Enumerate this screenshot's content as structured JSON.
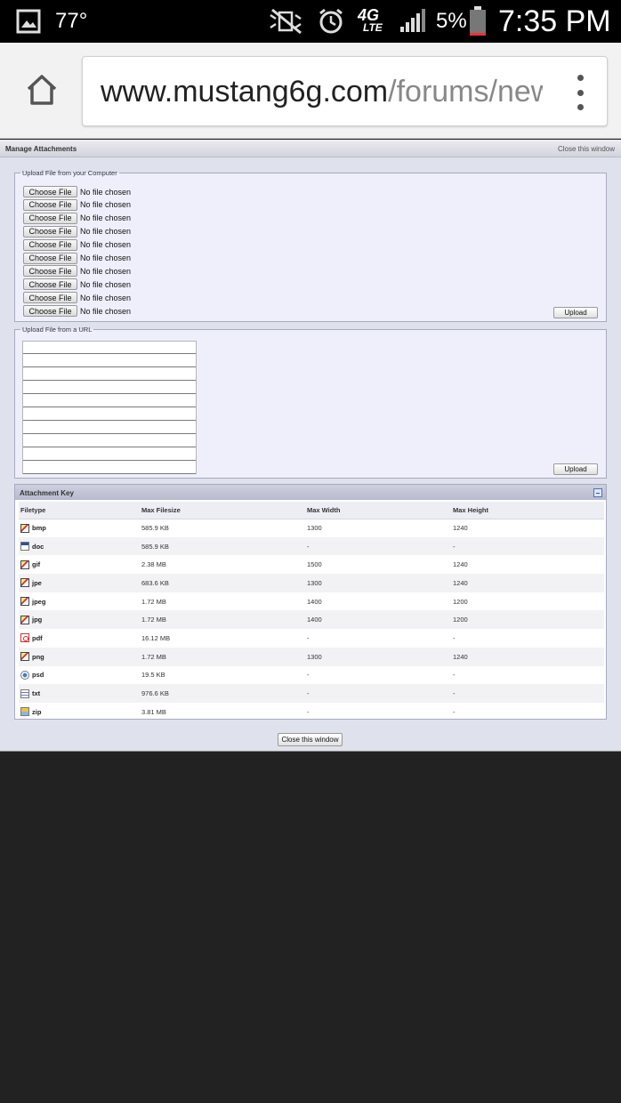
{
  "status_bar": {
    "temperature": "77°",
    "network": "4G",
    "network_sub": "LTE",
    "battery_percent": "5%",
    "time": "7:35 PM",
    "icons": [
      "gallery-icon",
      "mute-icon",
      "alarm-icon",
      "signal-icon",
      "battery-icon"
    ]
  },
  "browser": {
    "url_domain": "www.mustang6g.com",
    "url_path": "/forums/new"
  },
  "page": {
    "title": "Manage Attachments",
    "close_link": "Close this window",
    "upload_computer": {
      "legend": "Upload File from your Computer",
      "choose_label": "Choose File",
      "no_file_label": "No file chosen",
      "upload_label": "Upload"
    },
    "upload_url": {
      "legend": "Upload File from a URL",
      "upload_label": "Upload",
      "input_count": 10
    },
    "attachment_key": {
      "title": "Attachment Key",
      "columns": [
        "Filetype",
        "Max Filesize",
        "Max Width",
        "Max Height"
      ],
      "rows": [
        {
          "type": "bmp",
          "icon": "image-file-icon",
          "size": "585.9 KB",
          "width": "1300",
          "height": "1240"
        },
        {
          "type": "doc",
          "icon": "word-doc-icon",
          "size": "585.9 KB",
          "width": "-",
          "height": "-"
        },
        {
          "type": "gif",
          "icon": "image-file-icon",
          "size": "2.38 MB",
          "width": "1500",
          "height": "1240"
        },
        {
          "type": "jpe",
          "icon": "image-file-icon",
          "size": "683.6 KB",
          "width": "1300",
          "height": "1240"
        },
        {
          "type": "jpeg",
          "icon": "image-file-icon",
          "size": "1.72 MB",
          "width": "1400",
          "height": "1200"
        },
        {
          "type": "jpg",
          "icon": "image-file-icon",
          "size": "1.72 MB",
          "width": "1400",
          "height": "1200"
        },
        {
          "type": "pdf",
          "icon": "pdf-file-icon",
          "size": "16.12 MB",
          "width": "-",
          "height": "-"
        },
        {
          "type": "png",
          "icon": "image-file-icon",
          "size": "1.72 MB",
          "width": "1300",
          "height": "1240"
        },
        {
          "type": "psd",
          "icon": "psd-file-icon",
          "size": "19.5 KB",
          "width": "-",
          "height": "-"
        },
        {
          "type": "txt",
          "icon": "text-file-icon",
          "size": "976.6 KB",
          "width": "-",
          "height": "-"
        },
        {
          "type": "zip",
          "icon": "zip-file-icon",
          "size": "3.81 MB",
          "width": "-",
          "height": "-"
        }
      ]
    },
    "close_button": "Close this window"
  }
}
